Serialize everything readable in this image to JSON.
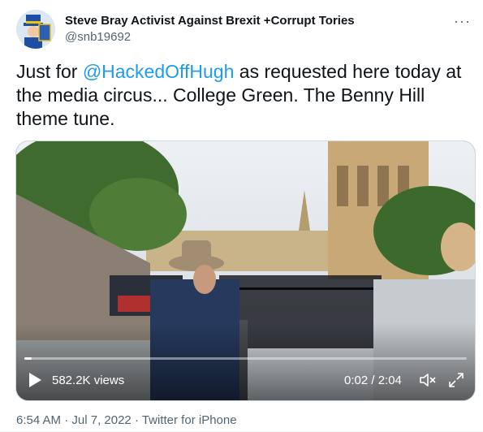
{
  "author": {
    "display_name": "Steve Bray Activist Against Brexit +Corrupt Tories",
    "handle": "@snb19692"
  },
  "tweet": {
    "text_before": "Just for ",
    "mention": "@HackedOffHugh",
    "text_after": " as requested here today at the media circus... College Green. The Benny Hill theme tune."
  },
  "video": {
    "views": "582.2K views",
    "time": "0:02 / 2:04",
    "progress": 0.016,
    "icons": [
      "play-icon",
      "volume-icon",
      "fullscreen-icon"
    ]
  },
  "meta": {
    "time": "6:54 AM",
    "separator": " · ",
    "date": "Jul 7, 2022",
    "client": "Twitter for iPhone"
  },
  "more_label": "···",
  "colors": {
    "link": "#1d9bf0",
    "secondary": "#536471"
  }
}
